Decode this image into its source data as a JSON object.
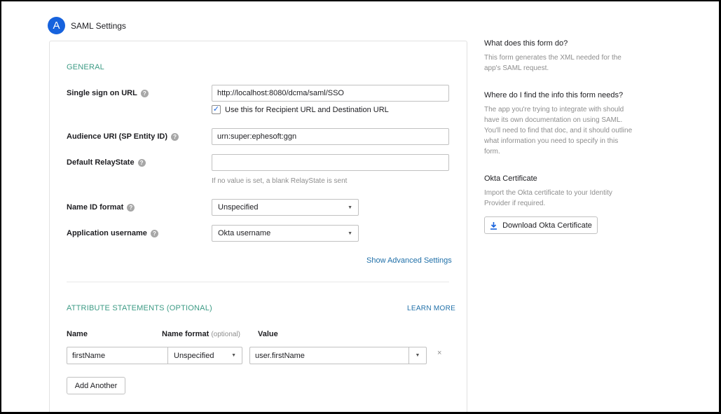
{
  "step": {
    "badge": "A",
    "title": "SAML Settings"
  },
  "general": {
    "section_title": "GENERAL",
    "sso_url": {
      "label": "Single sign on URL",
      "value": "http://localhost:8080/dcma/saml/SSO"
    },
    "recipient_checkbox": {
      "label": "Use this for Recipient URL and Destination URL",
      "checked": true
    },
    "audience_uri": {
      "label": "Audience URI (SP Entity ID)",
      "value": "urn:super:ephesoft:ggn"
    },
    "relay_state": {
      "label": "Default RelayState",
      "value": "",
      "hint": "If no value is set, a blank RelayState is sent"
    },
    "name_id_format": {
      "label": "Name ID format",
      "value": "Unspecified"
    },
    "app_username": {
      "label": "Application username",
      "value": "Okta username"
    },
    "advanced_link": "Show Advanced Settings"
  },
  "attributes": {
    "section_title": "ATTRIBUTE STATEMENTS (OPTIONAL)",
    "learn_more": "LEARN MORE",
    "col_name": "Name",
    "col_format": "Name format",
    "col_format_optional": "(optional)",
    "col_value": "Value",
    "rows": [
      {
        "name": "firstName",
        "format": "Unspecified",
        "value": "user.firstName"
      }
    ],
    "remove_glyph": "×",
    "add_button": "Add Another"
  },
  "sidebar": {
    "q1": "What does this form do?",
    "a1": "This form generates the XML needed for the app's SAML request.",
    "q2": "Where do I find the info this form needs?",
    "a2": "The app you're trying to integrate with should have its own documentation on using SAML. You'll need to find that doc, and it should outline what information you need to specify in this form.",
    "q3": "Okta Certificate",
    "a3": "Import the Okta certificate to your Identity Provider if required.",
    "download_button": "Download Okta Certificate"
  },
  "colors": {
    "accent_blue": "#1662dd",
    "section_green": "#3d9b85",
    "link_blue": "#1f6fa8"
  },
  "icons": {
    "help": "help-icon",
    "caret": "caret-down-icon",
    "download": "download-icon",
    "check": "checkmark-icon"
  }
}
